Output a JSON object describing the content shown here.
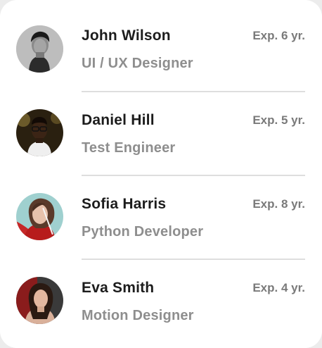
{
  "employees": [
    {
      "name": "John Wilson",
      "role": "UI / UX Designer",
      "experience": "Exp. 6 yr.",
      "avatar_icon": "person-photo-icon"
    },
    {
      "name": "Daniel Hill",
      "role": "Test Engineer",
      "experience": "Exp. 5 yr.",
      "avatar_icon": "person-photo-icon"
    },
    {
      "name": "Sofia Harris",
      "role": "Python Developer",
      "experience": "Exp. 8 yr.",
      "avatar_icon": "person-photo-icon"
    },
    {
      "name": "Eva Smith",
      "role": "Motion Designer",
      "experience": "Exp. 4 yr.",
      "avatar_icon": "person-photo-icon"
    }
  ],
  "colors": {
    "name_text": "#1c1c1c",
    "role_text": "#8e8e8e",
    "experience_text": "#7a7a7a",
    "divider": "#dedede",
    "card_background": "#ffffff"
  }
}
